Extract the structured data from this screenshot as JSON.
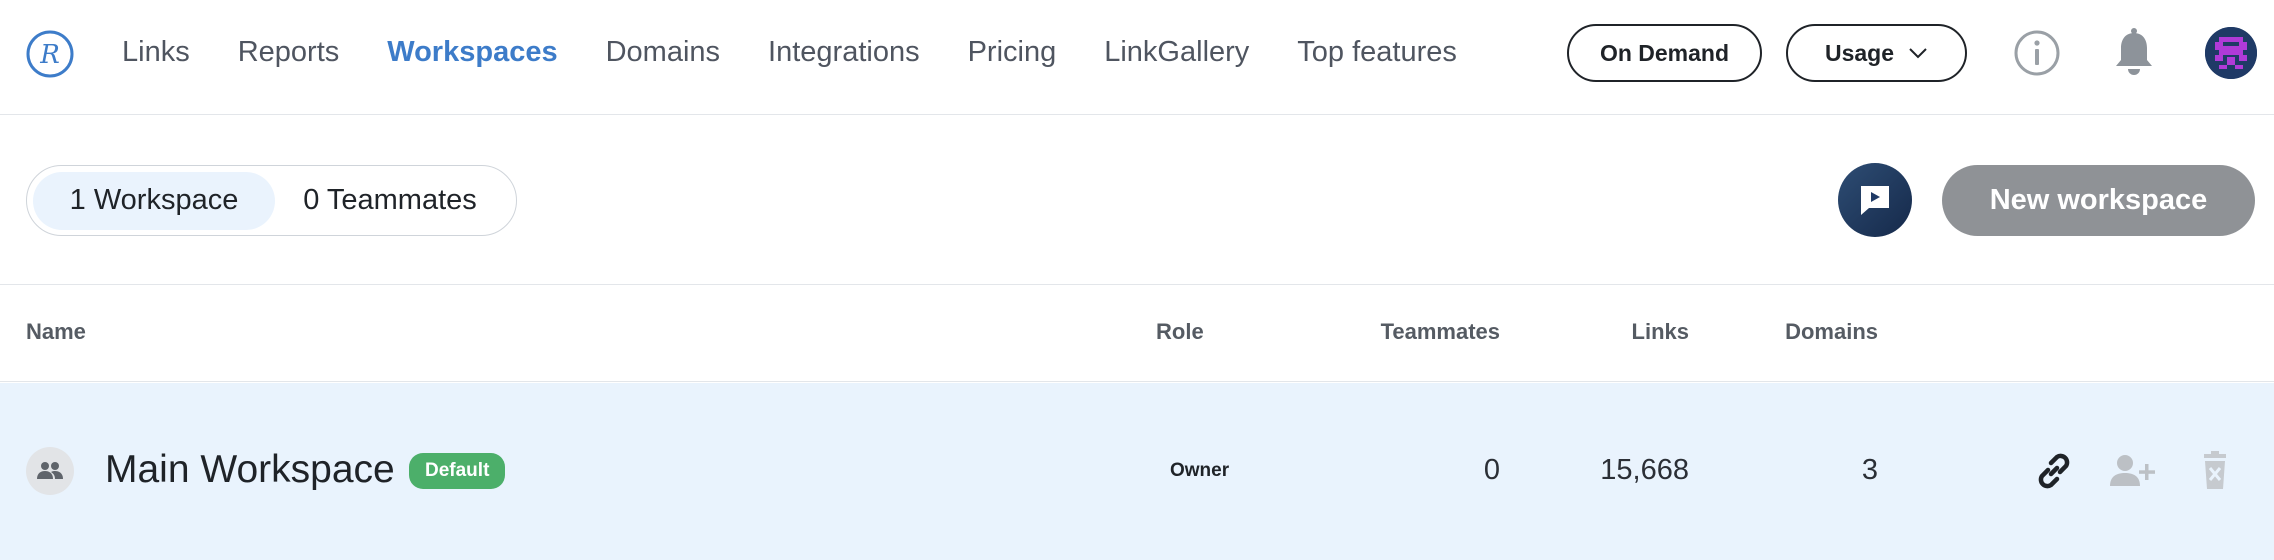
{
  "nav": {
    "logo_letter": "R",
    "items": [
      "Links",
      "Reports",
      "Workspaces",
      "Domains",
      "Integrations",
      "Pricing",
      "LinkGallery",
      "Top features"
    ],
    "active_index": 2,
    "on_demand_label": "On Demand",
    "usage_label": "Usage"
  },
  "icons": {
    "info": "info-icon",
    "notifications": "bell-icon",
    "avatar": "pixel-avatar",
    "help": "video-help-icon"
  },
  "toolbar": {
    "seg_workspaces": "1 Workspace",
    "seg_teammates": "0 Teammates",
    "new_workspace_label": "New workspace"
  },
  "table": {
    "headers": {
      "name": "Name",
      "role": "Role",
      "teammates": "Teammates",
      "links": "Links",
      "domains": "Domains"
    },
    "rows": [
      {
        "name": "Main Workspace",
        "badge": "Default",
        "role": "Owner",
        "teammates": "0",
        "links": "15,668",
        "domains": "3"
      }
    ]
  },
  "colors": {
    "brand_blue": "#3d7cc9",
    "row_highlight": "#e9f3fd",
    "badge_green": "#4caf6a",
    "disabled_button": "#8f9296"
  }
}
